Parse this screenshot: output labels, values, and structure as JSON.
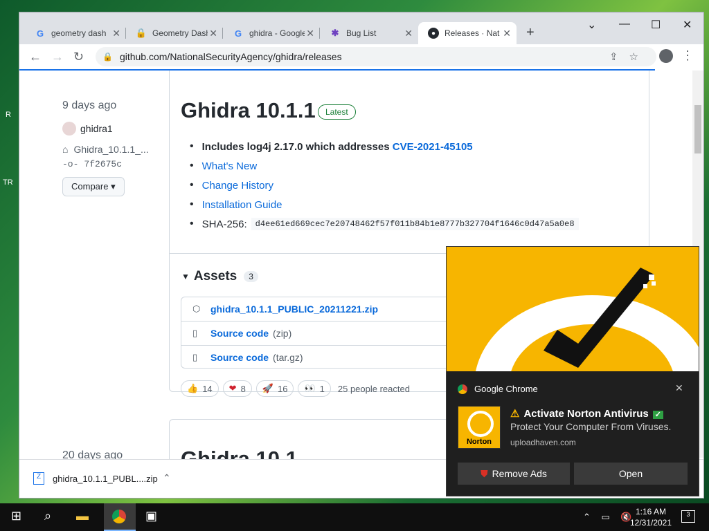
{
  "desktop": {
    "labels": [
      "R",
      "TR"
    ]
  },
  "browser": {
    "tabs": [
      {
        "title": "geometry dash",
        "favicon": "google-icon"
      },
      {
        "title": "Geometry Dash",
        "favicon": "lock-icon"
      },
      {
        "title": "ghidra - Google",
        "favicon": "google-icon"
      },
      {
        "title": "Bug List",
        "favicon": "bug-icon"
      },
      {
        "title": "Releases · National",
        "favicon": "github-icon"
      }
    ],
    "new_tab": "+",
    "url": "github.com/NationalSecurityAgency/ghidra/releases"
  },
  "release": {
    "date": "9 days ago",
    "author": "ghidra1",
    "tag": "Ghidra_10.1.1_...",
    "commit": "7f2675c",
    "compare_label": "Compare",
    "title": "Ghidra 10.1.1",
    "badge": "Latest",
    "notes": {
      "log4j_text": "Includes log4j 2.17.0 which addresses ",
      "cve_link": "CVE-2021-45105",
      "whats_new": "What's New",
      "change_history": "Change History",
      "install_guide": "Installation Guide",
      "sha_label": "SHA-256:",
      "sha_value": "d4ee61ed669cec7e20748462f57f011b84b1e8777b327704f1646c0d47a5a0e8"
    },
    "assets_label": "Assets",
    "assets_count": "3",
    "assets": [
      {
        "name": "ghidra_10.1.1_PUBLIC_20211221.zip",
        "ext": ""
      },
      {
        "name": "Source code",
        "ext": "(zip)"
      },
      {
        "name": "Source code",
        "ext": "(tar.gz)"
      }
    ],
    "reactions": [
      {
        "emoji": "👍",
        "count": "14"
      },
      {
        "emoji": "❤",
        "count": "8"
      },
      {
        "emoji": "🚀",
        "count": "16"
      },
      {
        "emoji": "👀",
        "count": "1"
      }
    ],
    "reacted_text": "25 people reacted"
  },
  "previous_release": {
    "date": "20 days ago",
    "title": "Ghidra 10.1"
  },
  "download": {
    "filename": "ghidra_10.1.1_PUBL....zip"
  },
  "notification": {
    "source": "Google Chrome",
    "title": "Activate Norton Antivirus",
    "body": "Protect Your Computer From Viruses.",
    "url": "uploadhaven.com",
    "logo_text": "Norton",
    "btn_remove": "Remove Ads",
    "btn_open": "Open"
  },
  "taskbar": {
    "time": "1:16 AM",
    "date": "12/31/2021",
    "notif_count": "3"
  }
}
